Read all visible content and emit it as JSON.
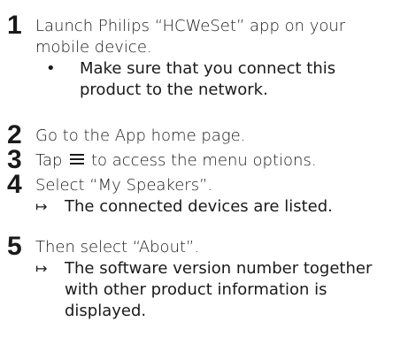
{
  "steps": [
    {
      "number": "1",
      "text": "Launch Philips “HCWeSet” app on your mobile device.",
      "bullet_mark": "•",
      "bullet": "Make sure that you connect this product to the network."
    },
    {
      "number": "2",
      "text": "Go to the App home page."
    },
    {
      "number": "3",
      "text_before": "Tap",
      "icon": "menu-icon",
      "text_after": "to access the menu options."
    },
    {
      "number": "4",
      "text": "Select “My Speakers”.",
      "arrow_mark": "↦",
      "result": "The connected devices are listed."
    },
    {
      "number": "5",
      "text": "Then select “About”.",
      "arrow_mark": "↦",
      "result": "The software version number together with other product information is displayed."
    }
  ]
}
